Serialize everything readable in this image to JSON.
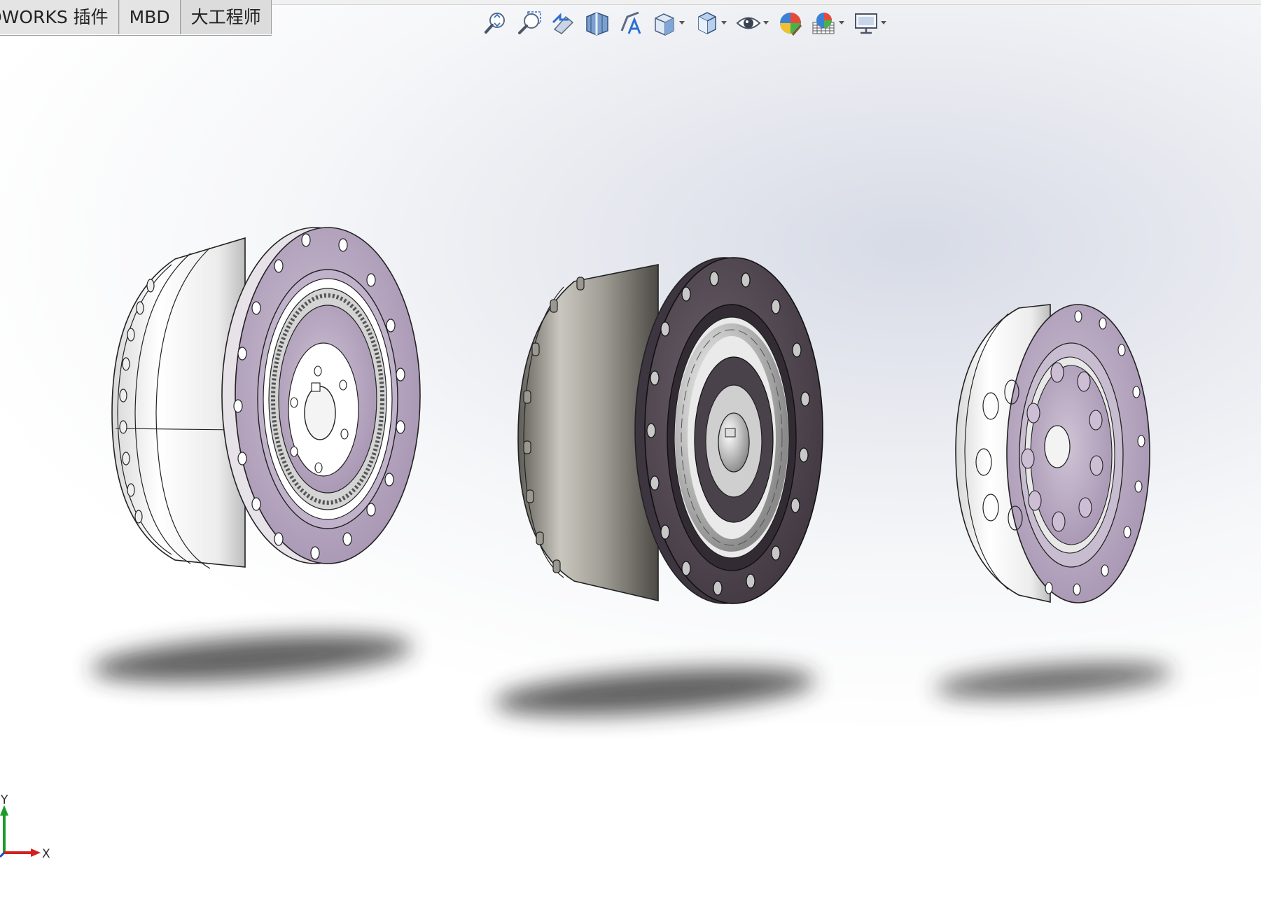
{
  "tabs": [
    {
      "label": "OWORKS 插件"
    },
    {
      "label": "MBD"
    },
    {
      "label": "大工程师"
    }
  ],
  "toolbar": {
    "icons": [
      "zoom-to-fit-icon",
      "zoom-to-area-icon",
      "previous-view-icon",
      "section-view-icon",
      "dynamic-annotation-icon",
      "view-orientation-icon",
      "display-style-icon",
      "hide-show-items-icon",
      "edit-appearance-icon",
      "apply-scene-icon",
      "view-settings-icon"
    ]
  },
  "triad": {
    "x_label": "X",
    "y_label": "Y"
  },
  "colors": {
    "accent_face": "#b9a9c3",
    "dark_face": "#4f4550",
    "housing_light": "#f2f2f2",
    "housing_dark": "#8c8a82",
    "triad_x": "#d02020",
    "triad_y": "#1e9a2a"
  }
}
